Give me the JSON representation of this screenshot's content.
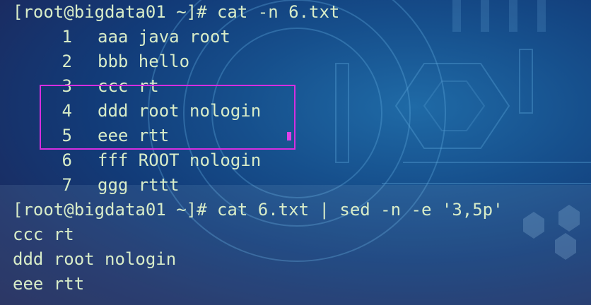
{
  "terminal": {
    "partial_top": "...",
    "lines": [
      {
        "type": "prompt",
        "text": "[root@bigdata01 ~]# cat -n 6.txt"
      },
      {
        "type": "numbered",
        "num": "1",
        "text": "aaa java root"
      },
      {
        "type": "numbered",
        "num": "2",
        "text": "bbb hello"
      },
      {
        "type": "numbered",
        "num": "3",
        "text": "ccc rt"
      },
      {
        "type": "numbered",
        "num": "4",
        "text": "ddd root nologin"
      },
      {
        "type": "numbered",
        "num": "5",
        "text": "eee rtt"
      },
      {
        "type": "numbered",
        "num": "6",
        "text": "fff ROOT nologin"
      },
      {
        "type": "numbered",
        "num": "7",
        "text": "ggg rttt"
      },
      {
        "type": "prompt",
        "text": "[root@bigdata01 ~]# cat 6.txt | sed -n -e '3,5p'"
      },
      {
        "type": "output",
        "text": "ccc rt"
      },
      {
        "type": "output",
        "text": "ddd root nologin"
      },
      {
        "type": "output",
        "text": "eee rtt"
      }
    ]
  },
  "colors": {
    "text": "#d8ecc8",
    "highlight_box": "#d62ee0"
  }
}
